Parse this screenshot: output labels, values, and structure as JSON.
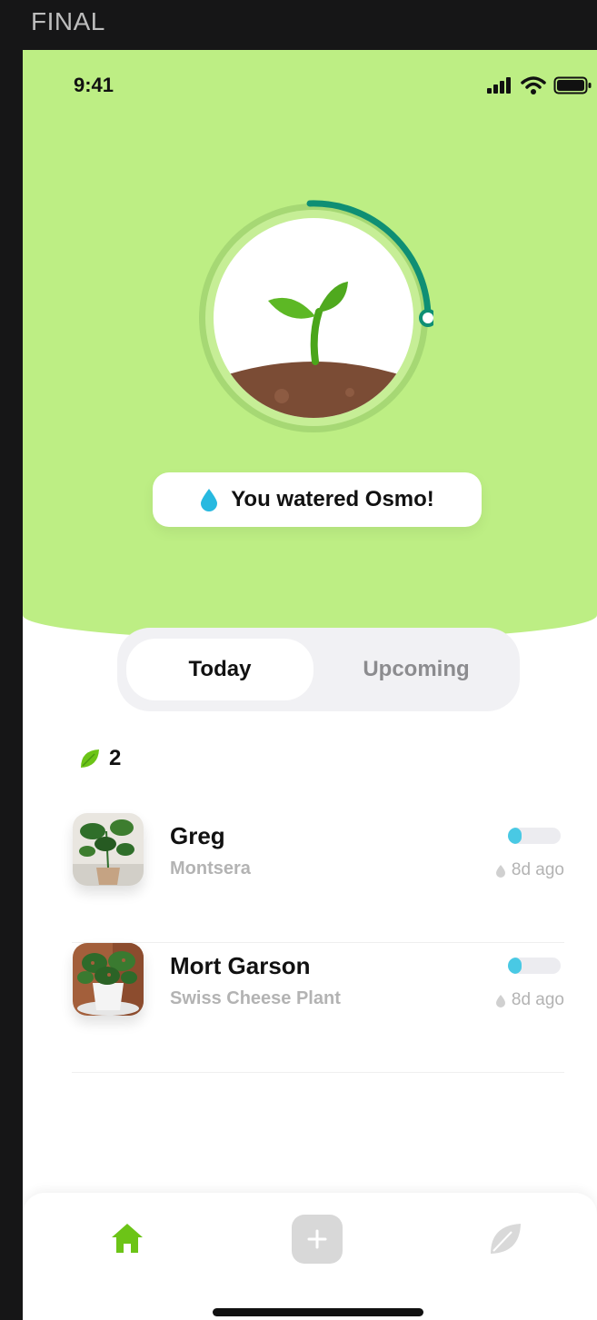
{
  "frame_label": "FINAL",
  "status_bar": {
    "time": "9:41",
    "icons": [
      "cellular-signal-icon",
      "wifi-icon",
      "battery-icon"
    ]
  },
  "hero": {
    "background_color": "#bdee84",
    "illustration": "sprout-icon",
    "progress_ring_color": "#0f8f74",
    "toast": {
      "icon": "water-drop-icon",
      "text": "You watered Osmo!"
    }
  },
  "tabs": [
    {
      "label": "Today",
      "selected": true
    },
    {
      "label": "Upcoming",
      "selected": false
    }
  ],
  "plant_count": {
    "icon": "leaf-icon",
    "value": "2"
  },
  "plants": [
    {
      "name": "Greg",
      "species": "Montsera",
      "thumbnail": "plant-photo",
      "water_level": 0.25,
      "last_watered": "8d ago"
    },
    {
      "name": "Mort Garson",
      "species": "Swiss Cheese Plant",
      "thumbnail": "plant-photo",
      "water_level": 0.25,
      "last_watered": "8d ago"
    }
  ],
  "bottom_nav": [
    {
      "icon": "home-icon",
      "active": true
    },
    {
      "icon": "add-icon",
      "active": false
    },
    {
      "icon": "leaf-icon",
      "active": false
    }
  ],
  "colors": {
    "accent_green": "#6cc417",
    "water_blue": "#49c9e4",
    "muted_text": "#b3b3b3"
  }
}
